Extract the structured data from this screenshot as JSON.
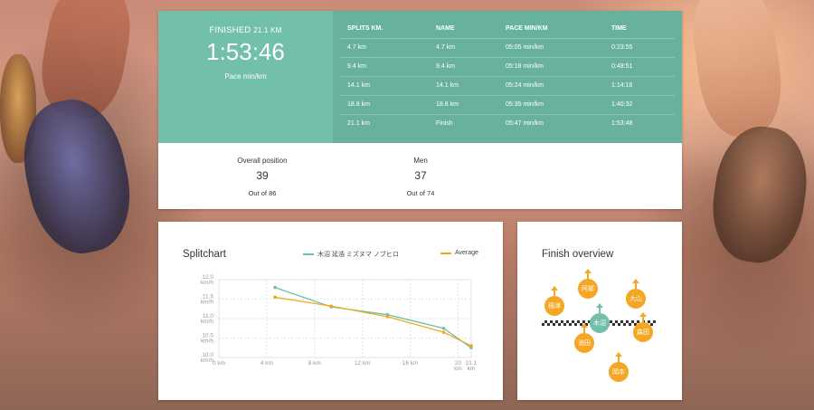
{
  "result": {
    "finished_label": "FINISHED",
    "distance": "21.1 KM",
    "finish_time": "1:53:46",
    "pace_label": "Pace min/km"
  },
  "splits": {
    "headers": [
      "SPLITS KM.",
      "NAME",
      "PACE MIN/KM",
      "TIME"
    ],
    "rows": [
      [
        "4.7 km",
        "4.7 km",
        "05:05 min/km",
        "0:23:55"
      ],
      [
        "9.4 km",
        "9.4 km",
        "05:18 min/km",
        "0:48:51"
      ],
      [
        "14.1 km",
        "14.1 km",
        "05:24 min/km",
        "1:14:16"
      ],
      [
        "18.8 km",
        "18.8 km",
        "05:35 min/km",
        "1:40:32"
      ],
      [
        "21.1 km",
        "Finish",
        "05:47 min/km",
        "1:53:48"
      ]
    ]
  },
  "stats": {
    "overall": {
      "label": "Overall position",
      "value": "39",
      "sub": "Out of 86"
    },
    "men": {
      "label": "Men",
      "value": "37",
      "sub": "Out of 74"
    }
  },
  "splitchart": {
    "title": "Splitchart",
    "legend_series": "木沼 延浩 ミズヌマ ノブヒロ",
    "legend_average": "Average"
  },
  "chart_data": {
    "type": "line",
    "x_unit": "km",
    "xlim": [
      0,
      21.1
    ],
    "x_ticks": [
      {
        "value": 0,
        "label": "0 km"
      },
      {
        "value": 4,
        "label": "4 km"
      },
      {
        "value": 8,
        "label": "8 km"
      },
      {
        "value": 12,
        "label": "12 km"
      },
      {
        "value": 16,
        "label": "16 km"
      },
      {
        "value": 20,
        "label": "20 km"
      },
      {
        "value": 21.1,
        "label": "21.1 km"
      }
    ],
    "ylim": [
      10.0,
      12.0
    ],
    "y_ticks": [
      {
        "value": 10.0,
        "label": "10.0 km/h"
      },
      {
        "value": 10.5,
        "label": "10.5 km/h"
      },
      {
        "value": 11.0,
        "label": "11.0 km/h"
      },
      {
        "value": 11.5,
        "label": "11.5 km/h"
      },
      {
        "value": 12.0,
        "label": "12.0 km/h"
      }
    ],
    "grid": true,
    "series": [
      {
        "name": "木沼 延浩 ミズヌマ ノブヒロ",
        "color": "#6cc0b0",
        "x": [
          4.7,
          9.4,
          14.1,
          18.8,
          21.1
        ],
        "values": [
          11.8,
          11.3,
          11.1,
          10.75,
          10.25
        ]
      },
      {
        "name": "Average",
        "color": "#f0a818",
        "x": [
          4.7,
          9.4,
          14.1,
          18.8,
          21.1
        ],
        "values": [
          11.55,
          11.32,
          11.05,
          10.65,
          10.3
        ]
      }
    ]
  },
  "finish_overview": {
    "title": "Finish overview",
    "runners": [
      {
        "id": "r1",
        "label": "稲津"
      },
      {
        "id": "r2",
        "label": "阿部"
      },
      {
        "id": "r3",
        "label": "大山"
      },
      {
        "id": "r4",
        "label": "木沼",
        "self": true
      },
      {
        "id": "r5",
        "label": "森田"
      },
      {
        "id": "r6",
        "label": "池田"
      },
      {
        "id": "r7",
        "label": "岡本"
      }
    ]
  },
  "colors": {
    "finished_green": "#72c0aa",
    "splits_green": "#68b29d",
    "accent_orange": "#f5a623"
  }
}
